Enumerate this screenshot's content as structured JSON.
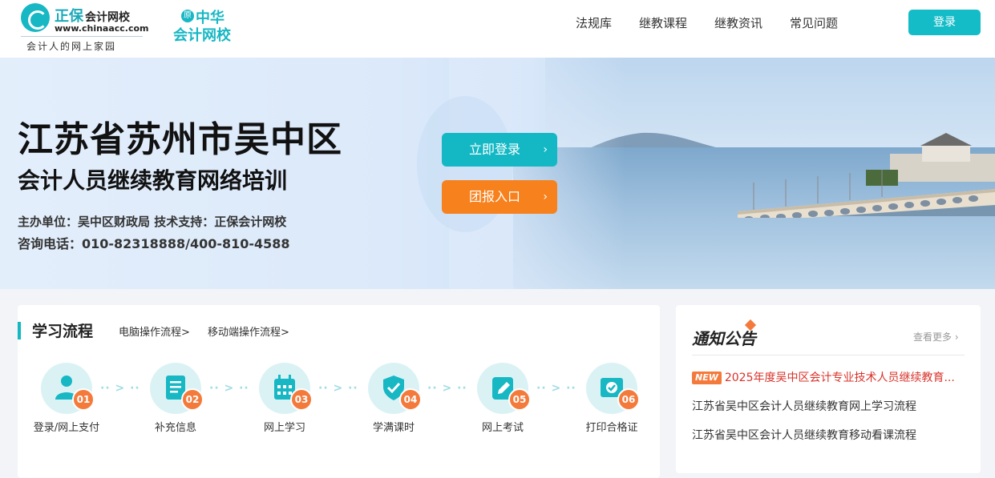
{
  "header": {
    "logo_brand": "正保",
    "logo_brand_suffix": "会计网校",
    "logo_url": "www.chinaacc.com",
    "logo_tagline": "会计人的网上家园",
    "logo2_badge": "原",
    "logo2_line1": "中华",
    "logo2_line2": "会计网校",
    "nav": [
      "法规库",
      "继教课程",
      "继教资讯",
      "常见问题"
    ],
    "login_label": "登录"
  },
  "banner": {
    "title": "江苏省苏州市吴中区",
    "subtitle": "会计人员继续教育网络培训",
    "info_line1": "主办单位：吴中区财政局  技术支持：正保会计网校",
    "info_line2": "咨询电话：010-82318888/400-810-4588",
    "cta_login": "立即登录",
    "cta_group": "团报入口",
    "cta_arrow": "›"
  },
  "process": {
    "title": "学习流程",
    "link_pc": "电脑操作流程>",
    "link_mobile": "移动端操作流程>",
    "connector": "·· > ··",
    "steps": [
      {
        "num": "01",
        "label": "登录/网上支付",
        "icon": "user-icon"
      },
      {
        "num": "02",
        "label": "补充信息",
        "icon": "document-icon"
      },
      {
        "num": "03",
        "label": "网上学习",
        "icon": "calendar-icon"
      },
      {
        "num": "04",
        "label": "学满课时",
        "icon": "shield-check-icon"
      },
      {
        "num": "05",
        "label": "网上考试",
        "icon": "edit-icon"
      },
      {
        "num": "06",
        "label": "打印合格证",
        "icon": "certificate-icon"
      }
    ]
  },
  "notice": {
    "title": "通知公告",
    "more": "查看更多",
    "new_badge": "NEW",
    "items": [
      "2025年度吴中区会计专业技术人员继续教育...",
      "江苏省吴中区会计人员继续教育网上学习流程",
      "江苏省吴中区会计人员继续教育移动看课流程"
    ]
  },
  "colors": {
    "accent": "#13b8c4",
    "orange": "#f7811d",
    "step_badge": "#f47a3c",
    "notice_hot": "#d9332a"
  }
}
